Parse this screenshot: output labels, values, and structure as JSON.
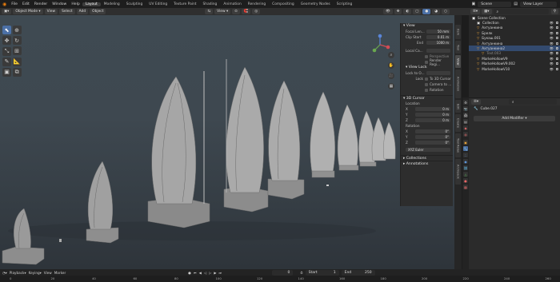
{
  "menu": {
    "items": [
      "File",
      "Edit",
      "Render",
      "Window",
      "Help"
    ],
    "workspaces": [
      "Layout",
      "Modeling",
      "Sculpting",
      "UV Editing",
      "Texture Paint",
      "Shading",
      "Animation",
      "Rendering",
      "Compositing",
      "Geometry Nodes",
      "Scripting"
    ],
    "active_workspace": "Layout",
    "scene": "Scene",
    "view_layer": "View Layer"
  },
  "viewport_header": {
    "mode": "Object Mode",
    "menus": [
      "View",
      "Select",
      "Add",
      "Object"
    ],
    "transform": "View",
    "options": "Options"
  },
  "npanel": {
    "view_title": "View",
    "focal_label": "Focal Len...",
    "focal_value": "50 mm",
    "clip_start_label": "Clip Start",
    "clip_start_value": "0.01 m",
    "clip_end_label": "End",
    "clip_end_value": "1000 m",
    "local_camera_label": "Local Ca...",
    "perspective_label": "Perspective",
    "render_region_label": "Render Regi...",
    "view_lock_title": "View Lock",
    "lock_object_label": "Lock to O...",
    "lock_label": "Lock",
    "to_3d_cursor": "To 3D Cursor",
    "camera_to": "Camera to ...",
    "rotation_check": "Rotation",
    "cursor_title": "3D Cursor",
    "location_label": "Location",
    "loc_x": "0 m",
    "loc_y": "0 m",
    "loc_z": "0 m",
    "rotation_label": "Rotation",
    "rot_x": "0°",
    "rot_y": "0°",
    "rot_z": "0°",
    "rot_mode": "XYZ Euler",
    "collections": "Collections",
    "annotations": "Annotations",
    "tabs": [
      "Item",
      "Tool",
      "View",
      "Animation",
      "Edit",
      "Create",
      "Tool Relax",
      "Archipack"
    ]
  },
  "outliner": {
    "search_placeholder": "",
    "rows": [
      {
        "label": "Scene Collection",
        "indent": 0
      },
      {
        "label": "Collection",
        "indent": 1
      },
      {
        "label": "Ахтуанкина",
        "indent": 1
      },
      {
        "label": "Брелк",
        "indent": 1
      },
      {
        "label": "Букаш.001",
        "indent": 1
      },
      {
        "label": "Ахтуанкина",
        "indent": 1
      },
      {
        "label": "Ахтуанкина2",
        "indent": 1,
        "selected": true
      },
      {
        "label": "Text.003",
        "indent": 2
      },
      {
        "label": "MarkeHollowV9",
        "indent": 1
      },
      {
        "label": "MarkeHollowV9.002",
        "indent": 1
      },
      {
        "label": "MarkeHollowV10",
        "indent": 1
      }
    ]
  },
  "properties": {
    "object_name": "Cube.027",
    "add_modifier": "Add Modifier"
  },
  "timeline": {
    "menus": [
      "Playback",
      "Keying",
      "View",
      "Marker"
    ],
    "current_frame": "0",
    "start_label": "Start",
    "start_value": "1",
    "end_label": "End",
    "end_value": "250",
    "ticks": [
      "0",
      "20",
      "40",
      "60",
      "80",
      "100",
      "120",
      "140",
      "160",
      "180",
      "200",
      "220",
      "240",
      "260"
    ]
  },
  "colors": {
    "accent": "#4b70a6",
    "viewport_bg": "#3f4a52",
    "panel_bg": "#2d2d2d",
    "selection": "#334a6e"
  }
}
